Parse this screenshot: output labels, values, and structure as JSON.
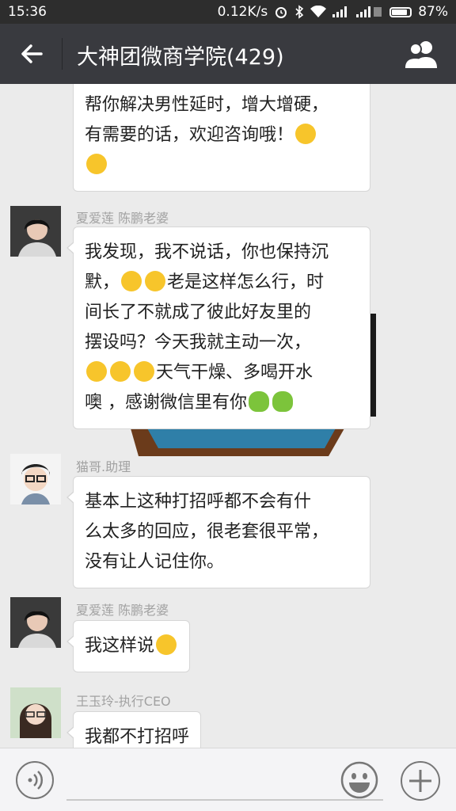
{
  "status": {
    "time": "15:36",
    "speed": "0.12K/s",
    "battery": "87%",
    "battery_level": 0.87
  },
  "header": {
    "title": "大神团微商学院(429)",
    "back_icon": "arrow-left-icon",
    "members_icon": "group-icon"
  },
  "messages": [
    {
      "sender": "",
      "lines": [
        "帮你解决男性延时，增大增硬，",
        "有需要的话，欢迎咨询哦！",
        ""
      ]
    },
    {
      "sender": "夏爱莲 陈鹏老婆",
      "lines": [
        "我发现，我不说话，你也保持沉",
        "默，",
        "老是这样怎么行，时",
        "间长了不就成了彼此好友里的",
        "摆设吗？今天我就主动一次，",
        "天气干燥、多喝开水",
        "噢 ，感谢微信里有你"
      ]
    },
    {
      "sender": "猫哥.助理",
      "lines": [
        "基本上这种打招呼都不会有什",
        "么太多的回应，很老套很平常，",
        "没有让人记住你。"
      ]
    },
    {
      "sender": "夏爱莲 陈鹏老婆",
      "lines": [
        "我这样说"
      ]
    },
    {
      "sender": "王玉玲-执行CEO",
      "lines": [
        "我都不打招呼"
      ]
    }
  ],
  "input": {
    "voice_icon": "voice-icon",
    "emoji_icon": "emoji-icon",
    "plus_icon": "plus-icon"
  }
}
